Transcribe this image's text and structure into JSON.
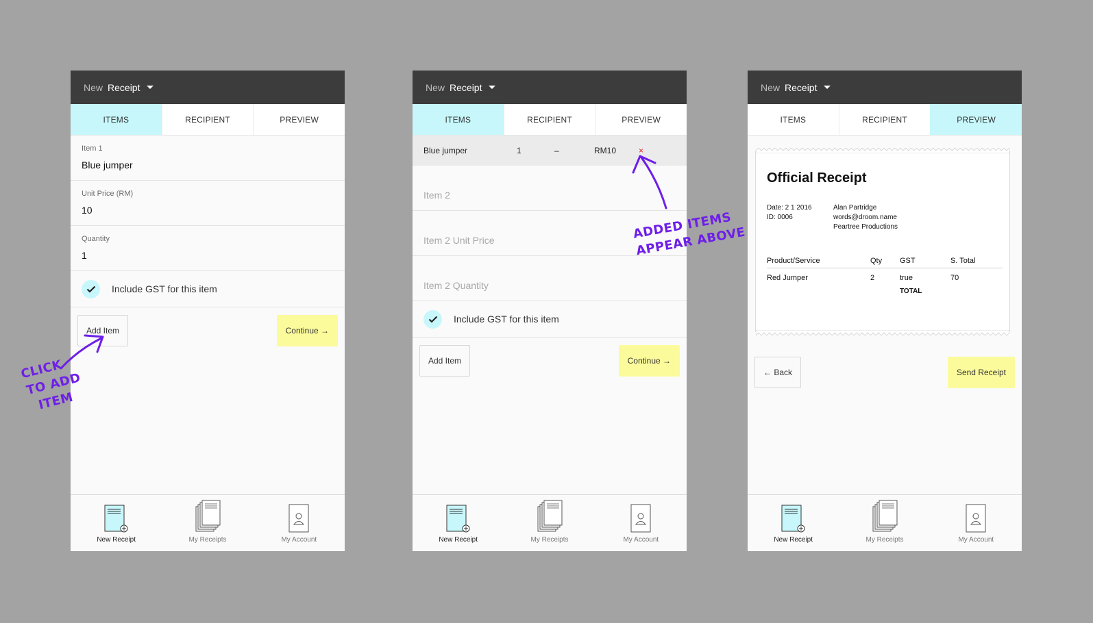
{
  "appbar": {
    "prefix": "New",
    "title": "Receipt"
  },
  "tabs": [
    "ITEMS",
    "RECIPIENT",
    "PREVIEW"
  ],
  "nav": [
    "New Receipt",
    "My Receipts",
    "My Account"
  ],
  "colors": {
    "accent": "#c7f7fb",
    "primary_button": "#fbfb9c",
    "annotation": "#6e1fe8",
    "remove": "#e02020"
  },
  "screen1": {
    "fields": [
      {
        "label": "Item 1",
        "value": "Blue jumper"
      },
      {
        "label": "Unit Price (RM)",
        "value": "10"
      },
      {
        "label": "Quantity",
        "value": "1"
      }
    ],
    "gst_label": "Include GST for this item",
    "add_item": "Add Item",
    "continue": "Continue →",
    "annotation": [
      "Click",
      "to add",
      "item"
    ]
  },
  "screen2": {
    "added_item": {
      "name": "Blue jumper",
      "qty": "1",
      "gst": "–",
      "price": "RM10",
      "remove": "×"
    },
    "placeholders": [
      "Item 2",
      "Item 2 Unit Price",
      "Item 2 Quantity"
    ],
    "gst_label": "Include GST for this item",
    "add_item": "Add Item",
    "continue": "Continue →",
    "annotation": [
      "Added items",
      "appear above"
    ]
  },
  "screen3": {
    "receipt": {
      "title": "Official Receipt",
      "date": "Date: 2 1 2016",
      "id": "ID: 0006",
      "name": "Alan Partridge",
      "email": "words@droom.name",
      "company": "Peartree Productions",
      "headers": [
        "Product/Service",
        "Qty",
        "GST",
        "S. Total"
      ],
      "row": [
        "Red Jumper",
        "2",
        "true",
        "70"
      ],
      "total_label": "TOTAL"
    },
    "back": "← Back",
    "send": "Send Receipt"
  }
}
